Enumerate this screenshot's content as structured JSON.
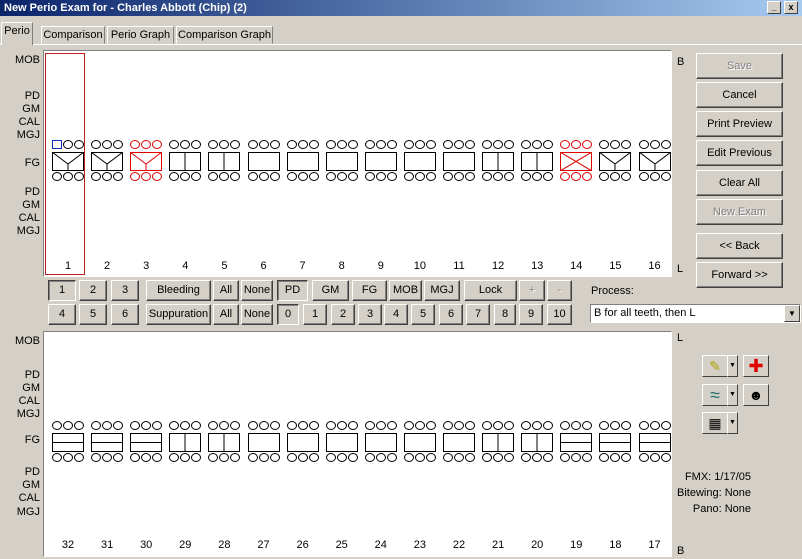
{
  "window": {
    "title": "New Perio Exam for - Charles Abbott (Chip) (2)",
    "minimize": "_",
    "close": "x"
  },
  "tabs": [
    "Perio",
    "Comparison",
    "Perio Graph",
    "Comparison Graph"
  ],
  "upper": {
    "row_labels": {
      "mob": "MOB",
      "pd": "PD",
      "gm": "GM",
      "cal": "CAL",
      "mgj": "MGJ",
      "fg": "FG",
      "pd2": "PD",
      "gm2": "GM",
      "cal2": "CAL",
      "mgj2": "MGJ"
    },
    "side_top": "B",
    "side_bottom": "L",
    "teeth": [
      {
        "num": "1",
        "style": "v",
        "red": false
      },
      {
        "num": "2",
        "style": "v",
        "red": false
      },
      {
        "num": "3",
        "style": "v",
        "red": true
      },
      {
        "num": "4",
        "style": "split",
        "red": false
      },
      {
        "num": "5",
        "style": "split",
        "red": false
      },
      {
        "num": "6",
        "style": "plain",
        "red": false
      },
      {
        "num": "7",
        "style": "plain",
        "red": false
      },
      {
        "num": "8",
        "style": "plain",
        "red": false
      },
      {
        "num": "9",
        "style": "plain",
        "red": false
      },
      {
        "num": "10",
        "style": "plain",
        "red": false
      },
      {
        "num": "11",
        "style": "plain",
        "red": false
      },
      {
        "num": "12",
        "style": "split",
        "red": false
      },
      {
        "num": "13",
        "style": "split",
        "red": false
      },
      {
        "num": "14",
        "style": "x",
        "red": true
      },
      {
        "num": "15",
        "style": "v",
        "red": false
      },
      {
        "num": "16",
        "style": "v",
        "red": false
      }
    ]
  },
  "lower": {
    "row_labels": {
      "mob": "MOB",
      "pd": "PD",
      "gm": "GM",
      "cal": "CAL",
      "mgj": "MGJ",
      "fg": "FG",
      "pd2": "PD",
      "gm2": "GM",
      "cal2": "CAL",
      "mgj2": "MGJ"
    },
    "side_top": "L",
    "side_bottom": "B",
    "teeth": [
      {
        "num": "32",
        "style": "hline",
        "red": false
      },
      {
        "num": "31",
        "style": "hline",
        "red": false
      },
      {
        "num": "30",
        "style": "hline",
        "red": false
      },
      {
        "num": "29",
        "style": "split",
        "red": false
      },
      {
        "num": "28",
        "style": "split",
        "red": false
      },
      {
        "num": "27",
        "style": "plain",
        "red": false
      },
      {
        "num": "26",
        "style": "plain",
        "red": false
      },
      {
        "num": "25",
        "style": "plain",
        "red": false
      },
      {
        "num": "24",
        "style": "plain",
        "red": false
      },
      {
        "num": "23",
        "style": "plain",
        "red": false
      },
      {
        "num": "22",
        "style": "plain",
        "red": false
      },
      {
        "num": "21",
        "style": "split",
        "red": false
      },
      {
        "num": "20",
        "style": "split",
        "red": false
      },
      {
        "num": "19",
        "style": "hline",
        "red": false
      },
      {
        "num": "18",
        "style": "hline",
        "red": false
      },
      {
        "num": "17",
        "style": "hline",
        "red": false
      }
    ]
  },
  "right_buttons": {
    "save": "Save",
    "cancel": "Cancel",
    "print_preview": "Print Preview",
    "edit_previous": "Edit Previous",
    "clear_all": "Clear All",
    "new_exam": "New Exam",
    "back": "<< Back",
    "forward": "Forward >>"
  },
  "controls": {
    "grid_buttons": [
      "1",
      "2",
      "3",
      "4",
      "5",
      "6"
    ],
    "bleeding": "Bleeding",
    "suppuration": "Suppuration",
    "all": "All",
    "none": "None",
    "measures": [
      "PD",
      "GM",
      "FG",
      "MOB",
      "MGJ"
    ],
    "lock": "Lock",
    "plus": "+",
    "minus": "-",
    "numbers": [
      "0",
      "1",
      "2",
      "3",
      "4",
      "5",
      "6",
      "7",
      "8",
      "9",
      "10"
    ],
    "process_label": "Process:",
    "process_value": "B for all teeth, then L",
    "combo_arrow": "▼"
  },
  "icons": {
    "note": "✎",
    "cross": "✚",
    "perio": "≈",
    "xray": "☻",
    "chart": "▦",
    "drop": "▼"
  },
  "info": {
    "fmx": "FMX: 1/17/05",
    "bitewing": "Bitewing: None",
    "pano": "Pano: None"
  },
  "colors": {
    "red": "#e00000",
    "title_start": "#0a246a",
    "selection": "#c02020"
  }
}
